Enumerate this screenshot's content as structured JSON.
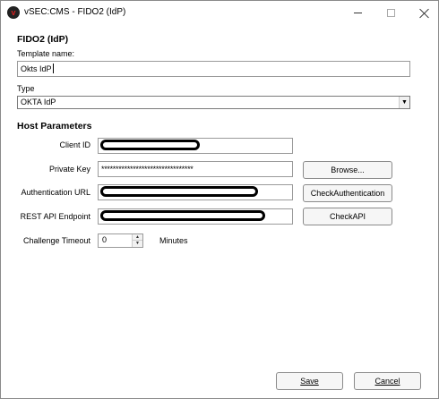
{
  "window": {
    "title": "vSEC:CMS - FIDO2 (IdP)",
    "app_icon_glyph": "v"
  },
  "form": {
    "heading": "FIDO2 (IdP)",
    "template_name_label": "Template name:",
    "template_name_value": "Okts IdP",
    "type_label": "Type",
    "type_value": "OKTA IdP",
    "combo_arrow": "▼"
  },
  "host": {
    "heading": "Host Parameters",
    "client_id_label": "Client ID",
    "private_key_label": "Private Key",
    "private_key_value": "********************************",
    "auth_url_label": "Authentication URL",
    "rest_api_label": "REST API Endpoint",
    "challenge_timeout_label": "Challenge Timeout",
    "challenge_timeout_value": "0",
    "minutes_label": "Minutes",
    "browse_label": "Browse...",
    "check_auth_label": "CheckAuthentication",
    "check_api_label": "CheckAPI"
  },
  "footer": {
    "save_label": "Save",
    "cancel_label": "Cancel"
  }
}
